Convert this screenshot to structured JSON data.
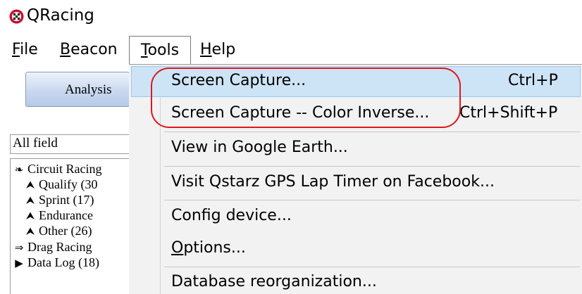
{
  "window": {
    "title": "QRacing",
    "icon": "qracing-app-icon"
  },
  "menubar": {
    "file": {
      "label": "File",
      "mnemonic": "F",
      "rest": "ile"
    },
    "beacon": {
      "label": "Beacon",
      "mnemonic": "B",
      "rest": "eacon"
    },
    "tools": {
      "label": "Tools",
      "mnemonic": "T",
      "rest": "ools"
    },
    "help": {
      "label": "Help",
      "mnemonic": "H",
      "rest": "elp"
    }
  },
  "left_panel": {
    "analysis_button": "Analysis",
    "field_filter": "All field",
    "tree": [
      {
        "icon": "circuit-icon",
        "label": "Circuit Racing"
      },
      {
        "icon": "flag-icon",
        "label": "Qualify (30"
      },
      {
        "icon": "flag-icon",
        "label": "Sprint (17)"
      },
      {
        "icon": "flag-icon",
        "label": "Endurance"
      },
      {
        "icon": "flag-icon",
        "label": "Other (26)"
      },
      {
        "icon": "double-arrow-icon",
        "label": "Drag Racing"
      },
      {
        "icon": "play-flag-icon",
        "label": "Data Log (18)"
      }
    ]
  },
  "tools_menu": {
    "items": [
      {
        "label": "Screen Capture...",
        "shortcut": "Ctrl+P"
      },
      {
        "label": "Screen Capture -- Color Inverse...",
        "shortcut": "Ctrl+Shift+P"
      },
      {
        "label": "View in Google Earth..."
      },
      {
        "label": "Visit Qstarz GPS Lap Timer on Facebook..."
      },
      {
        "label": "Config device..."
      },
      {
        "label": "Options...",
        "mnemonic": "O",
        "rest": "ptions..."
      },
      {
        "label": "Database reorganization..."
      }
    ]
  },
  "colors": {
    "hover_bg": "#cde4f7",
    "annotation_red": "#e2161b"
  }
}
